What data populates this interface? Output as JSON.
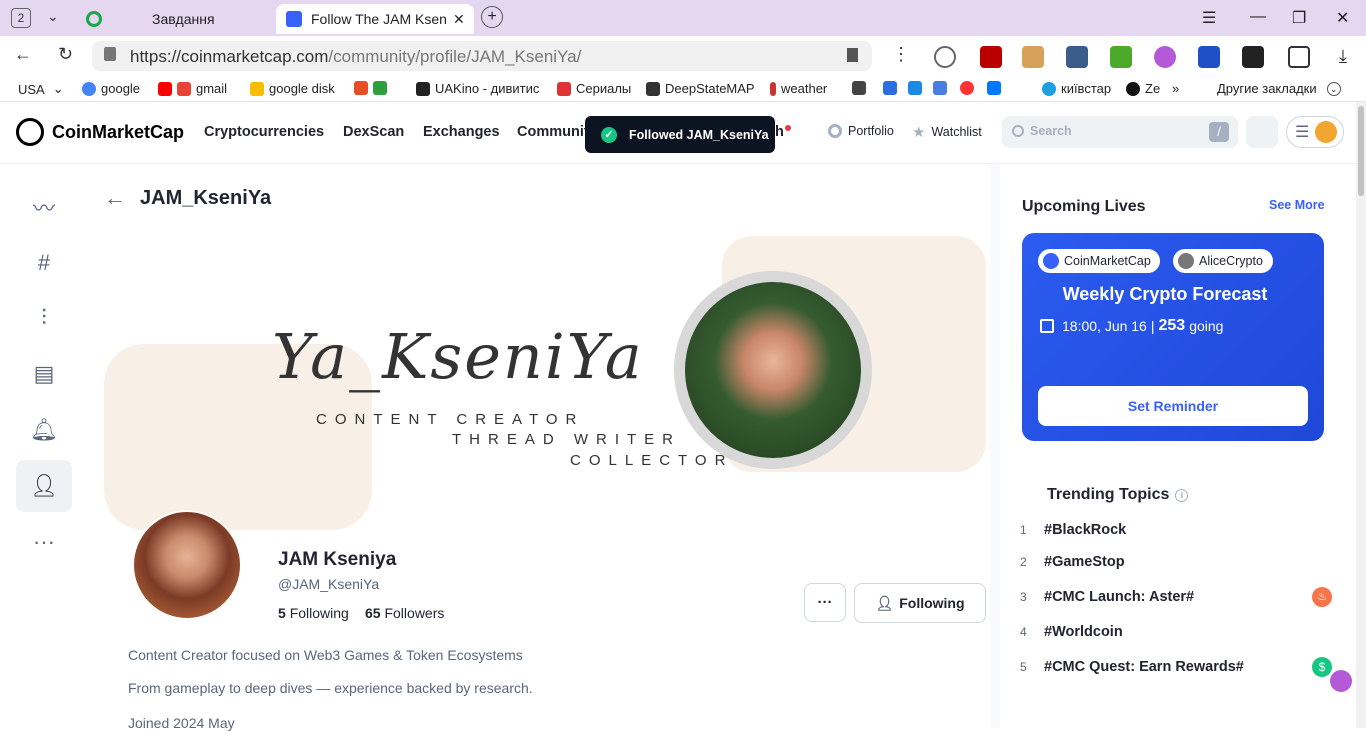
{
  "browser": {
    "tab_count": "2",
    "tabs": [
      {
        "label": "Завдання"
      },
      {
        "label": "Follow The JAM KseniYa"
      }
    ],
    "url_domain": "https://coinmarketcap.com",
    "url_path": "/community/profile/JAM_KseniYa/",
    "bookmarks": [
      "USA",
      "google",
      "gmail",
      "google disk",
      "UAKino - дивитис",
      "Сериалы",
      "DeepStateMAP",
      "weather",
      "київстар",
      "Ze"
    ],
    "other_bookmarks": "Другие закладки"
  },
  "header": {
    "logo_text": "CoinMarketCap",
    "nav": [
      "Cryptocurrencies",
      "DexScan",
      "Exchanges",
      "Communit",
      "h"
    ],
    "portfolio": "Portfolio",
    "watchlist": "Watchlist",
    "search_placeholder": "Search",
    "search_shortcut": "/"
  },
  "toast": {
    "text": "Followed JAM_KseniYa"
  },
  "profile": {
    "back_title": "JAM_KseniYa",
    "banner_script": "Ya_KseniYa",
    "banner_lines": [
      "CONTENT CREATOR",
      "THREAD WRITER",
      "COLLECTOR"
    ],
    "display_name": "JAM Kseniya",
    "handle": "@JAM_KseniYa",
    "following_count": "5",
    "following_label": "Following",
    "followers_count": "65",
    "followers_label": "Followers",
    "more_button": "···",
    "follow_button": "Following",
    "bio_1": "Content Creator focused on Web3 Games & Token Ecosystems",
    "bio_2": "From gameplay to deep dives — experience backed by research.",
    "joined": "Joined 2024 May"
  },
  "upcoming": {
    "title": "Upcoming Lives",
    "see_more": "See More",
    "host_1": "CoinMarketCap",
    "host_2": "AliceCrypto",
    "event_title": "Weekly Crypto Forecast",
    "event_time": "18:00, Jun 16",
    "going_count": "253",
    "going_label": "going",
    "reminder_button": "Set Reminder"
  },
  "trending": {
    "title": "Trending Topics",
    "items": [
      {
        "rank": "1",
        "label": "#BlackRock"
      },
      {
        "rank": "2",
        "label": "#GameStop"
      },
      {
        "rank": "3",
        "label": "#CMC Launch: Aster#"
      },
      {
        "rank": "4",
        "label": "#Worldcoin"
      },
      {
        "rank": "5",
        "label": "#CMC Quest: Earn Rewards#"
      }
    ]
  },
  "colors": {
    "accent": "#3861fb",
    "toast_bg": "#0d1421",
    "success": "#16c784",
    "tab_strip": "#e6d7f0"
  }
}
